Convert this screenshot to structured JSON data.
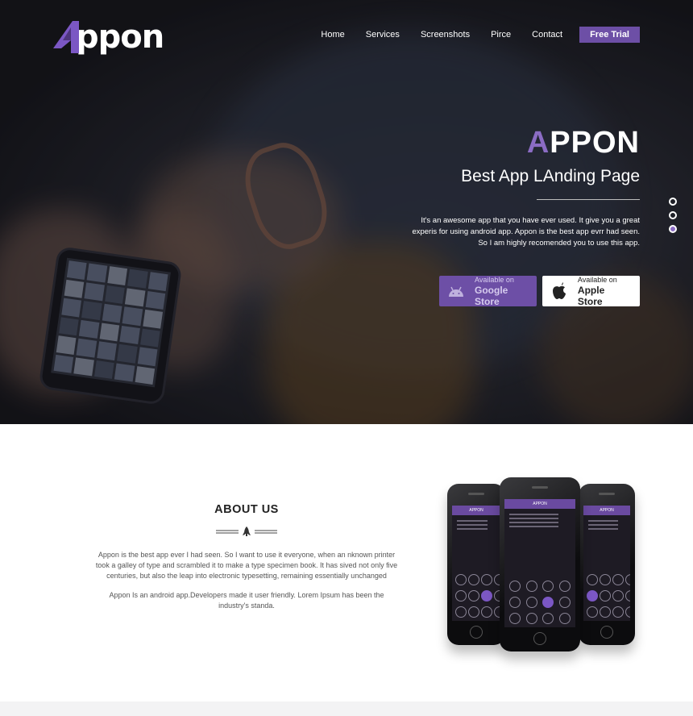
{
  "brand": {
    "logo_text": "ppon",
    "logo_initial": "A"
  },
  "nav": {
    "items": [
      "Home",
      "Services",
      "Screenshots",
      "Pirce",
      "Contact"
    ],
    "cta": "Free Trial"
  },
  "hero": {
    "title_first": "A",
    "title_rest": "PPON",
    "subtitle": "Best App LAnding Page",
    "description": "It's an awesome app that you have ever used. It give you a great experis for using android app. Appon is the best app evrr had seen. So I am highly recomended you to use this app.",
    "google": {
      "small": "Available on",
      "big": "Google Store",
      "icon": "android-icon"
    },
    "apple": {
      "small": "Available on",
      "big": "Apple Store",
      "icon": "apple-icon"
    },
    "slider_dots": 3,
    "active_dot": 3
  },
  "about": {
    "title": "ABOUT US",
    "p1": "Appon is the best app ever I had seen. So I want to use it everyone, when an nknown printer took a galley of type and scrambled it to make a type specimen book. It has sived not only five centuries, but also the leap into electronic typesetting, remaining essentially unchanged",
    "p2": "Appon Is an android app.Developers made it user friendly. Lorem Ipsum has been the industry's standa."
  },
  "phones": {
    "screen_title": "APPON"
  },
  "colors": {
    "accent": "#6d4fa6",
    "accent_light": "#8b6cc4"
  }
}
